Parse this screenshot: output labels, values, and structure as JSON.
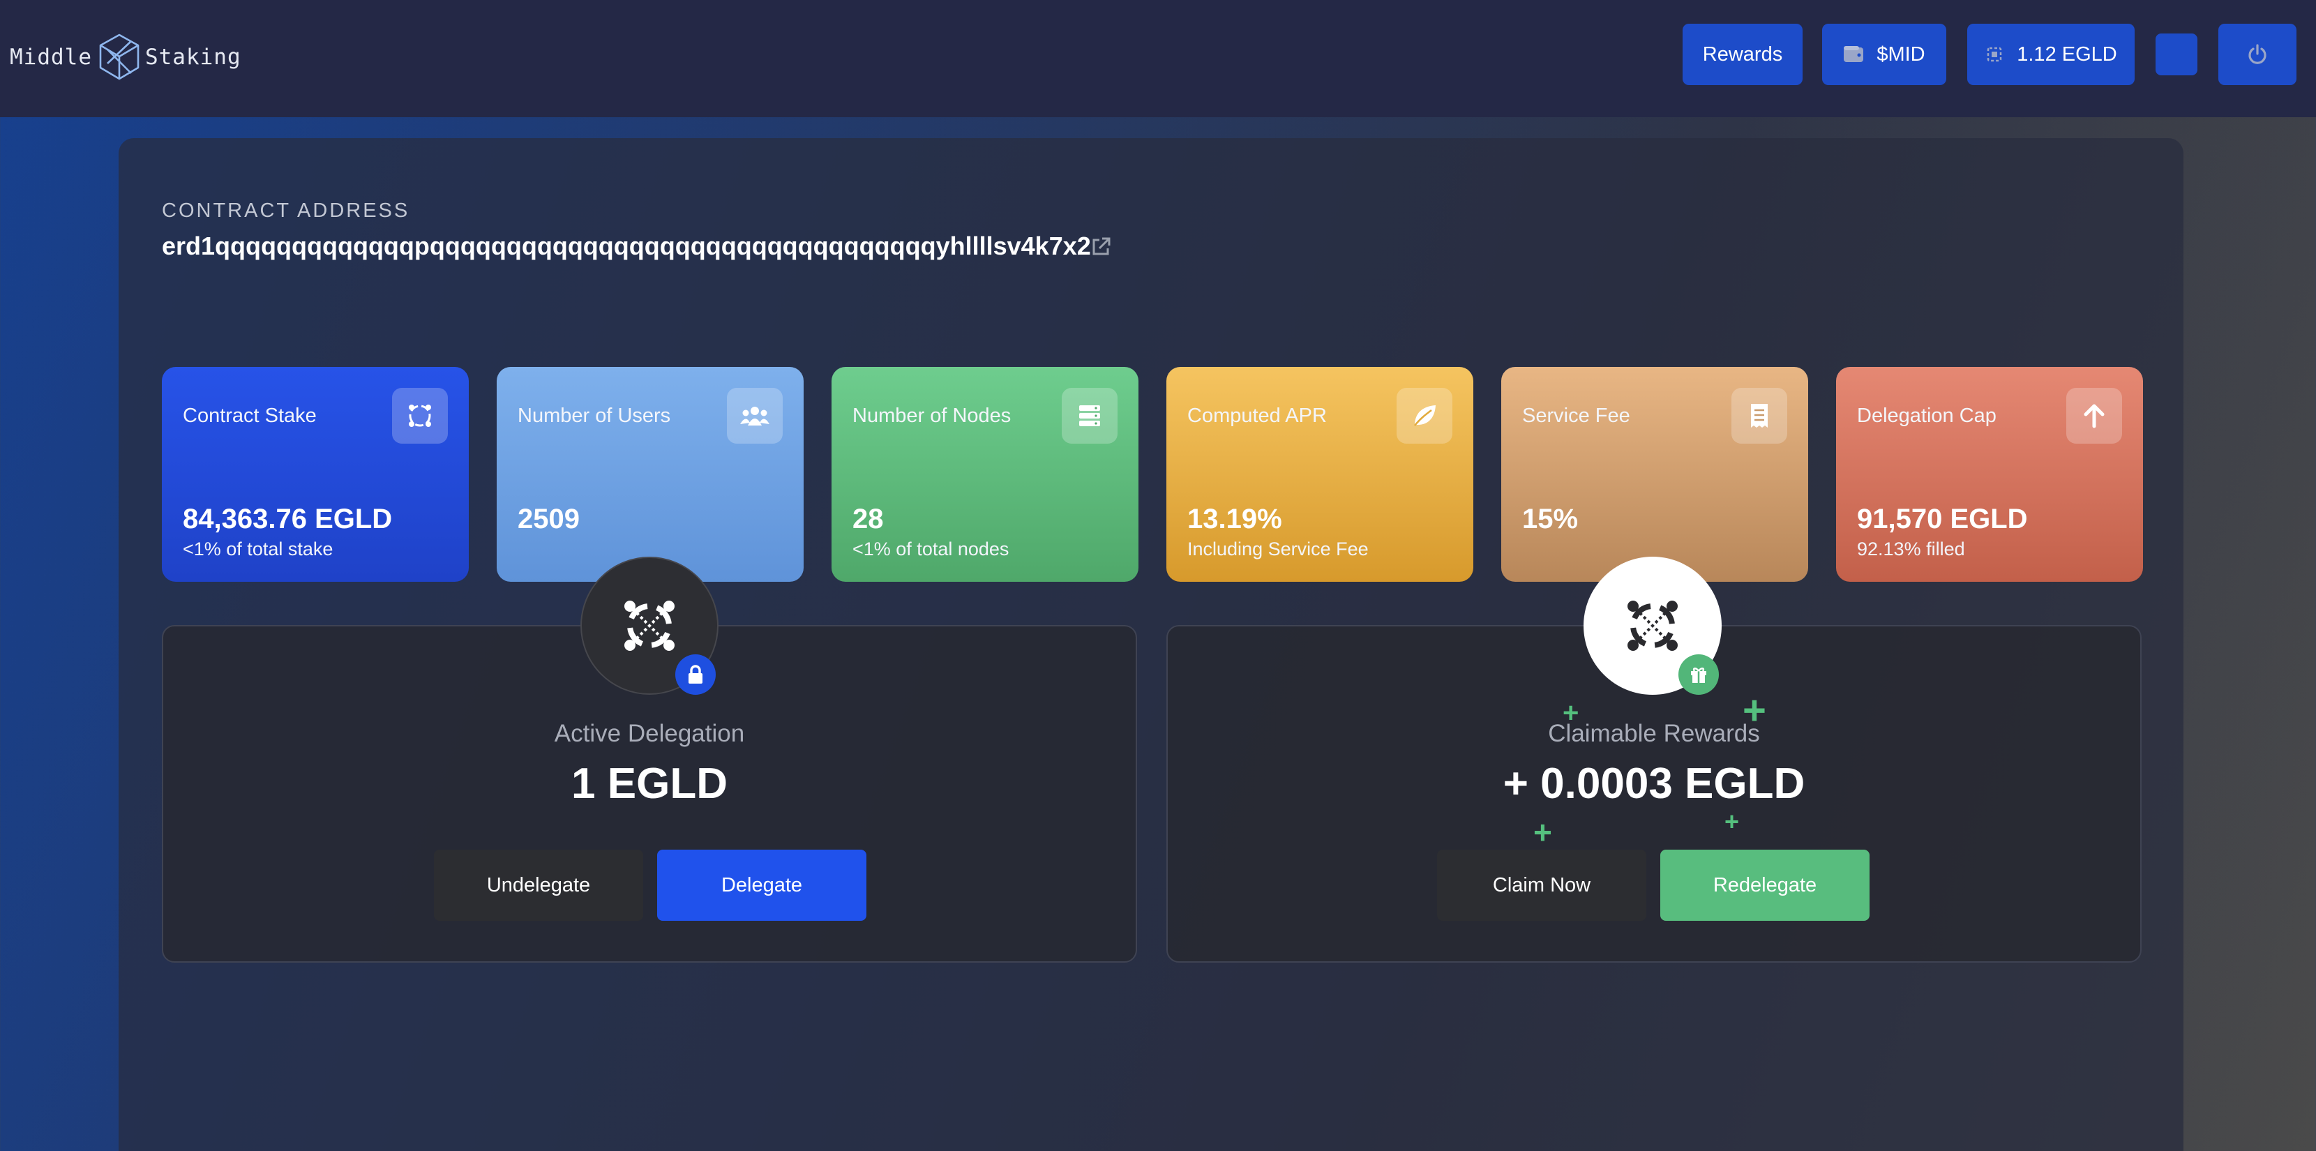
{
  "header": {
    "logo_left": "Middle",
    "logo_right": "Staking",
    "rewards_label": "Rewards",
    "token_label": "$MID",
    "balance_label": "1.12 EGLD",
    "icons": {
      "token": "wallet-icon",
      "balance": "chip-icon",
      "power": "power-icon"
    }
  },
  "contract": {
    "label": "CONTRACT ADDRESS",
    "address": "erd1qqqqqqqqqqqqqpqqqqqqqqqqqqqqqqqqqqqqqqqqqqqqqqqyhllllsv4k7x2"
  },
  "stats": [
    {
      "title": "Contract Stake",
      "value": "84,363.76 EGLD",
      "sub": "<1% of total stake",
      "icon": "egld-icon",
      "color": "#2753e8"
    },
    {
      "title": "Number of Users",
      "value": "2509",
      "sub": "",
      "icon": "users-icon",
      "color": "#7eb0ec"
    },
    {
      "title": "Number of Nodes",
      "value": "28",
      "sub": "<1% of total nodes",
      "icon": "server-icon",
      "color": "#6ecd8e"
    },
    {
      "title": "Computed APR",
      "value": "13.19%",
      "sub": "Including Service Fee",
      "icon": "leaf-icon",
      "color": "#f5c460"
    },
    {
      "title": "Service Fee",
      "value": "15%",
      "sub": "",
      "icon": "receipt-icon",
      "color": "#e8b684"
    },
    {
      "title": "Delegation Cap",
      "value": "91,570 EGLD",
      "sub": "92.13% filled",
      "icon": "arrow-up-icon",
      "color": "#e58873"
    }
  ],
  "delegation": {
    "label": "Active Delegation",
    "amount": "1 EGLD",
    "undelegate_label": "Undelegate",
    "delegate_label": "Delegate"
  },
  "rewards": {
    "label": "Claimable Rewards",
    "amount": "+ 0.0003 EGLD",
    "claim_label": "Claim Now",
    "redelegate_label": "Redelegate"
  }
}
